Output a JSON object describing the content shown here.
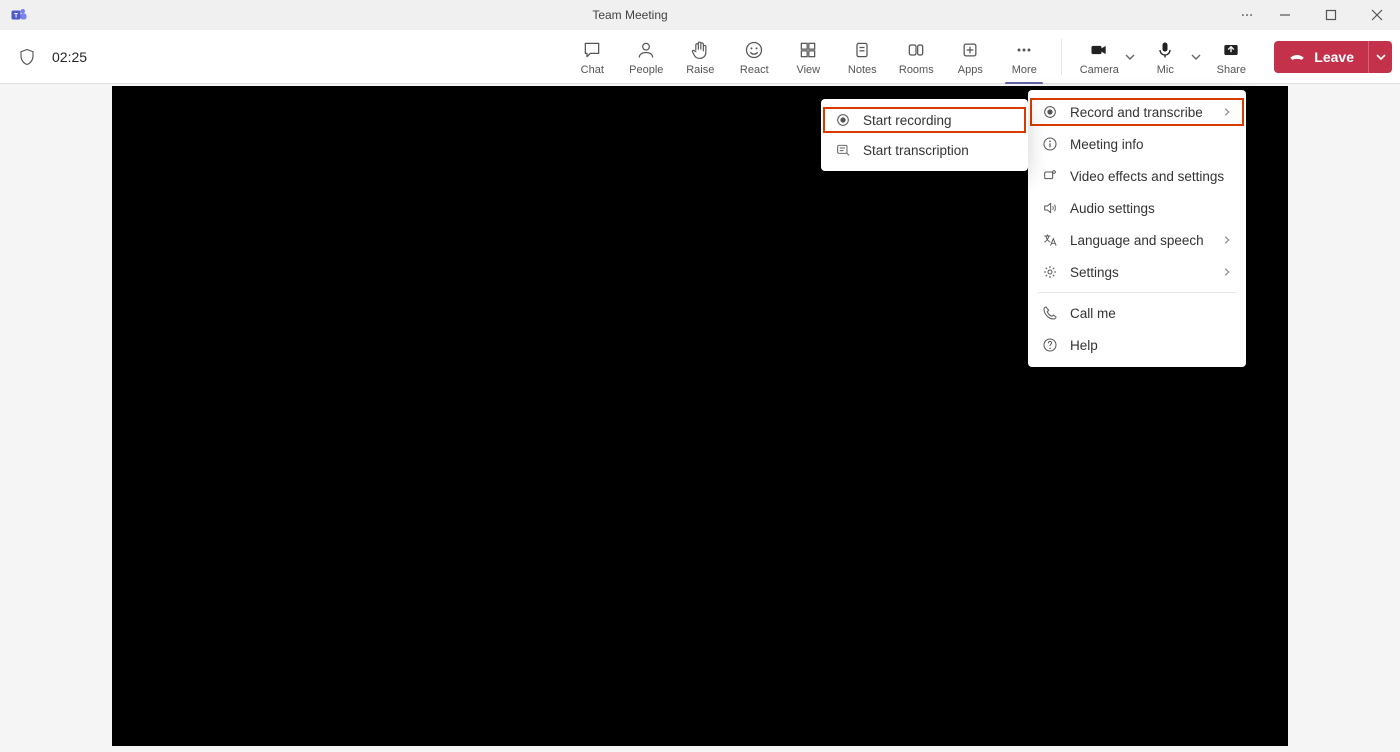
{
  "title": "Team Meeting",
  "timer": "02:25",
  "toolbar": {
    "chat": "Chat",
    "people": "People",
    "raise": "Raise",
    "react": "React",
    "view": "View",
    "notes": "Notes",
    "rooms": "Rooms",
    "apps": "Apps",
    "more": "More",
    "camera": "Camera",
    "mic": "Mic",
    "share": "Share",
    "leave": "Leave"
  },
  "moreMenu": {
    "record": "Record and transcribe",
    "info": "Meeting info",
    "video": "Video effects and settings",
    "audio": "Audio settings",
    "lang": "Language and speech",
    "settings": "Settings",
    "callme": "Call me",
    "help": "Help"
  },
  "recordSubmenu": {
    "startRec": "Start recording",
    "startTrans": "Start transcription"
  }
}
